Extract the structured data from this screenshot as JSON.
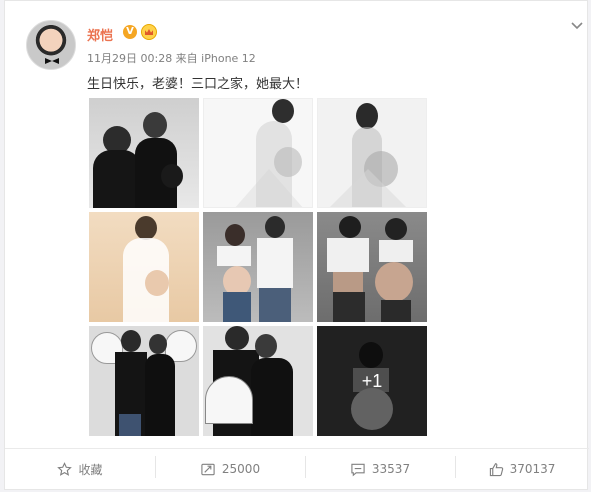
{
  "post": {
    "author": "郑恺",
    "verified_badge": "V",
    "timestamp": "11月29日 00:28 来自 iPhone 12",
    "text": "生日快乐，老婆！三口之家，她最大！",
    "more_photos_label": "+1"
  },
  "actions": {
    "favorite_label": "收藏",
    "repost_count": "25000",
    "comment_count": "33537",
    "like_count": "370137"
  },
  "icons": {
    "favorite": "star-icon",
    "repost": "repost-icon",
    "comment": "comment-icon",
    "like": "thumbs-up-icon",
    "menu": "chevron-down-icon"
  },
  "colors": {
    "author_name": "#eb7350",
    "meta_text": "#808080",
    "body_text": "#333333"
  }
}
